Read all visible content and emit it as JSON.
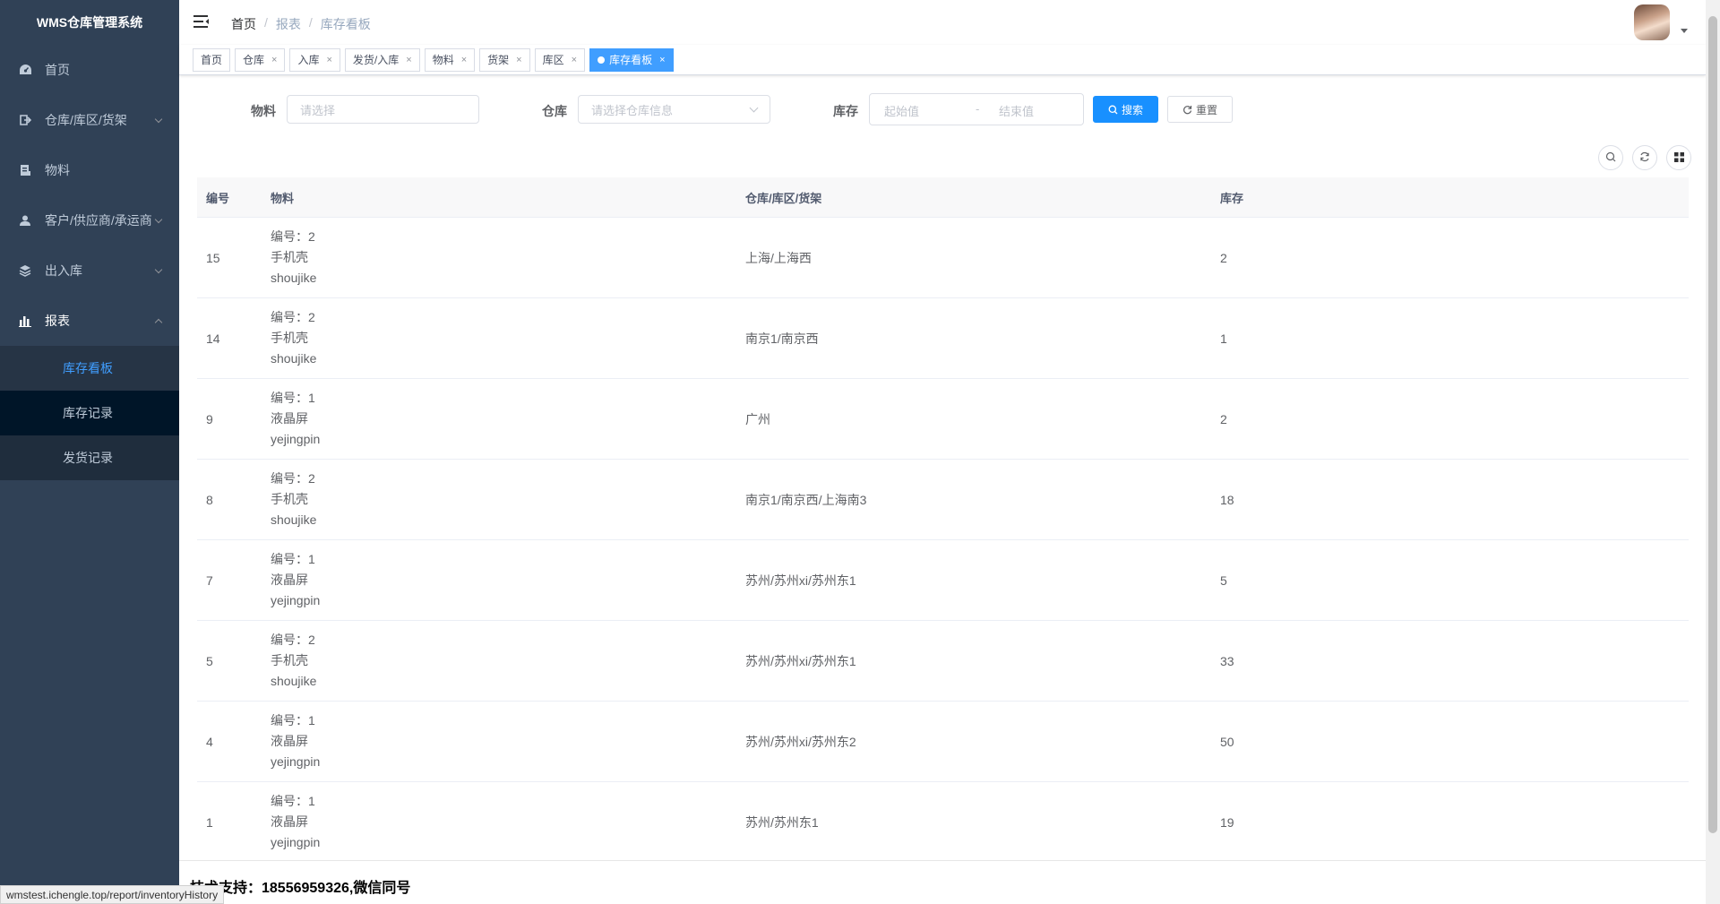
{
  "app": {
    "title": "WMS仓库管理系统"
  },
  "sidebar": {
    "items": [
      {
        "label": "首页",
        "icon": "dashboard-icon"
      },
      {
        "label": "仓库/库区/货架",
        "icon": "warehouse-icon"
      },
      {
        "label": "物料",
        "icon": "material-icon"
      },
      {
        "label": "客户/供应商/承运商",
        "icon": "user-icon"
      },
      {
        "label": "出入库",
        "icon": "layers-icon"
      },
      {
        "label": "报表",
        "icon": "chart-icon"
      }
    ],
    "sub_items": [
      {
        "label": "库存看板"
      },
      {
        "label": "库存记录"
      },
      {
        "label": "发货记录"
      }
    ]
  },
  "breadcrumb": [
    "首页",
    "报表",
    "库存看板"
  ],
  "tags": [
    {
      "label": "首页"
    },
    {
      "label": "仓库"
    },
    {
      "label": "入库"
    },
    {
      "label": "发货/入库"
    },
    {
      "label": "物料"
    },
    {
      "label": "货架"
    },
    {
      "label": "库区"
    },
    {
      "label": "库存看板"
    }
  ],
  "search": {
    "material_label": "物料",
    "material_placeholder": "请选择",
    "warehouse_label": "仓库",
    "warehouse_placeholder": "请选择仓库信息",
    "stock_label": "库存",
    "stock_start_placeholder": "起始值",
    "stock_separator": "-",
    "stock_end_placeholder": "结束值",
    "search_button": "搜索",
    "reset_button": "重置"
  },
  "table": {
    "columns": [
      "编号",
      "物料",
      "仓库/库区/货架",
      "库存"
    ],
    "material_no_prefix": "编号：",
    "rows": [
      {
        "id": "15",
        "mat_no": "2",
        "mat_name": "手机壳",
        "mat_code": "shoujike",
        "location": "上海/上海西",
        "stock": "2"
      },
      {
        "id": "14",
        "mat_no": "2",
        "mat_name": "手机壳",
        "mat_code": "shoujike",
        "location": "南京1/南京西",
        "stock": "1"
      },
      {
        "id": "9",
        "mat_no": "1",
        "mat_name": "液晶屏",
        "mat_code": "yejingpin",
        "location": "广州",
        "stock": "2"
      },
      {
        "id": "8",
        "mat_no": "2",
        "mat_name": "手机壳",
        "mat_code": "shoujike",
        "location": "南京1/南京西/上海南3",
        "stock": "18"
      },
      {
        "id": "7",
        "mat_no": "1",
        "mat_name": "液晶屏",
        "mat_code": "yejingpin",
        "location": "苏州/苏州xi/苏州东1",
        "stock": "5"
      },
      {
        "id": "5",
        "mat_no": "2",
        "mat_name": "手机壳",
        "mat_code": "shoujike",
        "location": "苏州/苏州xi/苏州东1",
        "stock": "33"
      },
      {
        "id": "4",
        "mat_no": "1",
        "mat_name": "液晶屏",
        "mat_code": "yejingpin",
        "location": "苏州/苏州xi/苏州东2",
        "stock": "50"
      },
      {
        "id": "1",
        "mat_no": "1",
        "mat_name": "液晶屏",
        "mat_code": "yejingpin",
        "location": "苏州/苏州东1",
        "stock": "19"
      }
    ]
  },
  "footer": {
    "text": "技术支持：18556959326,微信同号"
  },
  "status_url": "wmstest.ichengle.top/report/inventoryHistory",
  "colors": {
    "sidebar_bg": "#304156",
    "submenu_bg": "#1f2d3d",
    "accent": "#409eff",
    "primary_button": "#1890ff"
  }
}
